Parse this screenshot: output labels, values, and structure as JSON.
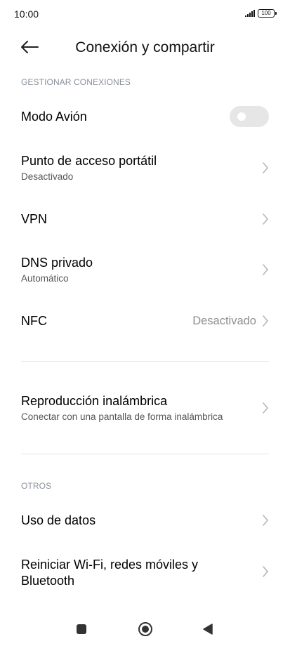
{
  "status_bar": {
    "time": "10:00",
    "battery": "100"
  },
  "header": {
    "back_icon": "arrow-left-icon",
    "title": "Conexión y compartir"
  },
  "sections": {
    "manage": "GESTIONAR CONEXIONES",
    "others": "OTROS"
  },
  "items": {
    "airplane": {
      "title": "Modo Avión",
      "enabled": false
    },
    "hotspot": {
      "title": "Punto de acceso portátil",
      "subtitle": "Desactivado"
    },
    "vpn": {
      "title": "VPN"
    },
    "dns": {
      "title": "DNS privado",
      "subtitle": "Automático"
    },
    "nfc": {
      "title": "NFC",
      "value": "Desactivado"
    },
    "wireless_display": {
      "title": "Reproducción inalámbrica",
      "subtitle": "Conectar con una pantalla de forma inalámbrica"
    },
    "data_usage": {
      "title": "Uso de datos"
    },
    "reset": {
      "title_line1": "Reiniciar Wi-Fi, redes móviles y",
      "title_line2": "Bluetooth"
    }
  },
  "nav_bar": {
    "buttons": [
      "square-recents-icon",
      "circle-home-icon",
      "triangle-back-icon"
    ]
  },
  "colors": {
    "background": "#ffffff",
    "section_label": "#8a8f99",
    "secondary_text": "#555555",
    "chevron": "#b3b3b3",
    "toggle_off": "#e6e6e6"
  }
}
